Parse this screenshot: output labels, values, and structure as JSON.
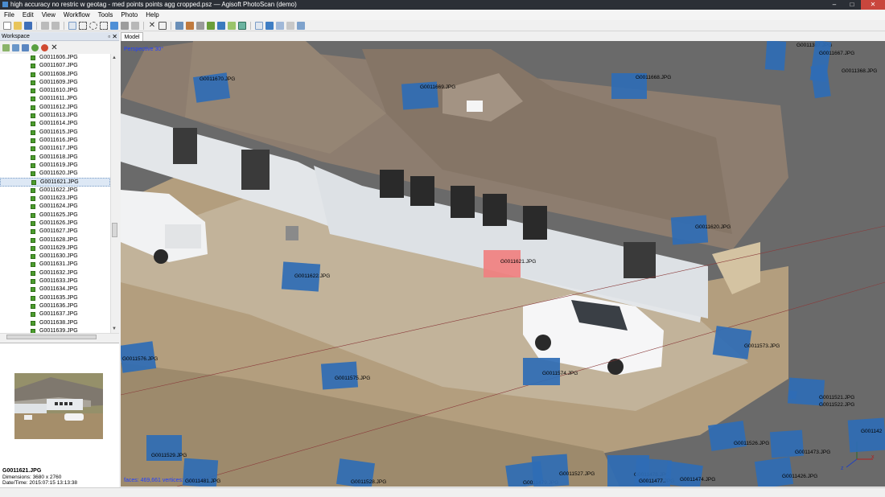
{
  "window": {
    "title": "high accuracy no restric w geotag - med points points agg cropped.psz — Agisoft PhotoScan (demo)",
    "controls": [
      "–",
      "□",
      "✕"
    ]
  },
  "menu": [
    "File",
    "Edit",
    "View",
    "Workflow",
    "Tools",
    "Photo",
    "Help"
  ],
  "workspace": {
    "title": "Workspace",
    "controls": "▫ ✕",
    "photos": [
      "G0011606.JPG",
      "G0011607.JPG",
      "G0011608.JPG",
      "G0011609.JPG",
      "G0011610.JPG",
      "G0011611.JPG",
      "G0011612.JPG",
      "G0011613.JPG",
      "G0011614.JPG",
      "G0011615.JPG",
      "G0011616.JPG",
      "G0011617.JPG",
      "G0011618.JPG",
      "G0011619.JPG",
      "G0011620.JPG",
      "G0011621.JPG",
      "G0011622.JPG",
      "G0011623.JPG",
      "G0011624.JPG",
      "G0011625.JPG",
      "G0011626.JPG",
      "G0011627.JPG",
      "G0011628.JPG",
      "G0011629.JPG",
      "G0011630.JPG",
      "G0011631.JPG",
      "G0011632.JPG",
      "G0011633.JPG",
      "G0011634.JPG",
      "G0011635.JPG",
      "G0011636.JPG",
      "G0011637.JPG",
      "G0011638.JPG",
      "G0011639.JPG"
    ],
    "selected_photo": "G0011621.JPG"
  },
  "preview": {
    "name": "G0011621.JPG",
    "dimensions": "Dimensions: 3680 x 2760",
    "datetime": "Date/Time: 2015:07:15 13:13:38"
  },
  "viewport": {
    "tab": "Model",
    "perspective": "Perspective 30°",
    "stats": "faces: 469,661 vertices: 235,480",
    "cameras": [
      {
        "label": "G0011670.JPG",
        "highlight": false
      },
      {
        "label": "G0011669.JPG",
        "highlight": false
      },
      {
        "label": "G0011668.JPG",
        "highlight": false
      },
      {
        "label": "G0011367.JPG",
        "highlight": false
      },
      {
        "label": "G0011667.JPG",
        "highlight": false
      },
      {
        "label": "G0011368.JPG",
        "highlight": false
      },
      {
        "label": "G0011620.JPG",
        "highlight": false
      },
      {
        "label": "G0011621.JPG",
        "highlight": true
      },
      {
        "label": "G0011622.JPG",
        "highlight": false
      },
      {
        "label": "G0011573.JPG",
        "highlight": false
      },
      {
        "label": "G0011576.JPG",
        "highlight": false
      },
      {
        "label": "G0011575.JPG",
        "highlight": false
      },
      {
        "label": "G0011574.JPG",
        "highlight": false
      },
      {
        "label": "G0011521.JPG",
        "highlight": false
      },
      {
        "label": "G0011522.JPG",
        "highlight": false
      },
      {
        "label": "G0011526.JPG",
        "highlight": false
      },
      {
        "label": "G0011473.JPG",
        "highlight": false
      },
      {
        "label": "G0011529.JPG",
        "highlight": false
      },
      {
        "label": "G0011481.JPG",
        "highlight": false
      },
      {
        "label": "G0011528.JPG",
        "highlight": false
      },
      {
        "label": "G0011479.JPG",
        "highlight": false
      },
      {
        "label": "G0011527.JPG",
        "highlight": false
      },
      {
        "label": "G0011478.JPG",
        "highlight": false
      },
      {
        "label": "G0011477.JPG",
        "highlight": false
      },
      {
        "label": "G0011474.JPG",
        "highlight": false
      },
      {
        "label": "G0011426.JPG",
        "highlight": false
      },
      {
        "label": "G001142",
        "highlight": false
      }
    ],
    "axis_labels": {
      "x": "x",
      "y": "y",
      "z": "z"
    }
  },
  "colors": {
    "camera": "#2f6db5",
    "camera_selected": "#f08080",
    "perspective_text": "#2040ff",
    "roof": "#8d7d6f",
    "wall": "#e6e9ec",
    "ground": "#b59f7d"
  }
}
